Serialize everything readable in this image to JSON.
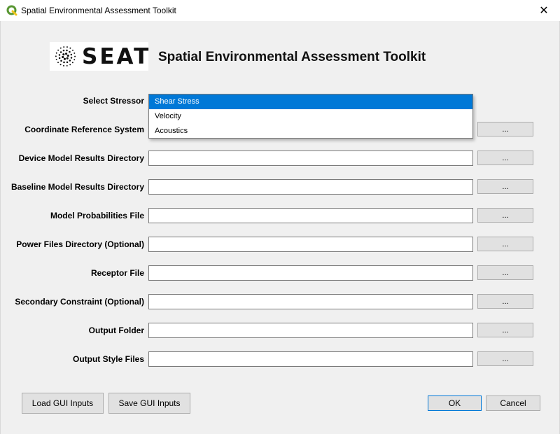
{
  "window": {
    "title": "Spatial Environmental Assessment Toolkit",
    "close_symbol": "✕",
    "app_icon": "qgis-icon"
  },
  "header": {
    "logo_text": "SEAT",
    "title": "Spatial Environmental Assessment Toolkit"
  },
  "stressor": {
    "label": "Select Stressor",
    "options": [
      "Shear Stress",
      "Velocity",
      "Acoustics"
    ],
    "selected": "Shear Stress"
  },
  "fields": [
    {
      "label": "Coordinate Reference System",
      "value": "",
      "browse": "..."
    },
    {
      "label": "Device Model Results Directory",
      "value": "",
      "browse": "..."
    },
    {
      "label": "Baseline Model Results Directory",
      "value": "",
      "browse": "..."
    },
    {
      "label": "Model Probabilities File",
      "value": "",
      "browse": "..."
    },
    {
      "label": "Power Files Directory (Optional)",
      "value": "",
      "browse": "..."
    },
    {
      "label": "Receptor File",
      "value": "",
      "browse": "..."
    },
    {
      "label": "Secondary Constraint (Optional)",
      "value": "",
      "browse": "..."
    },
    {
      "label": "Output Folder",
      "value": "",
      "browse": "..."
    },
    {
      "label": "Output Style Files",
      "value": "",
      "browse": "..."
    }
  ],
  "buttons": {
    "load": "Load GUI Inputs",
    "save": "Save GUI Inputs",
    "ok": "OK",
    "cancel": "Cancel"
  },
  "colors": {
    "selection": "#0078d7",
    "qgis_green": "#589632",
    "qgis_yellow": "#f0c419"
  }
}
